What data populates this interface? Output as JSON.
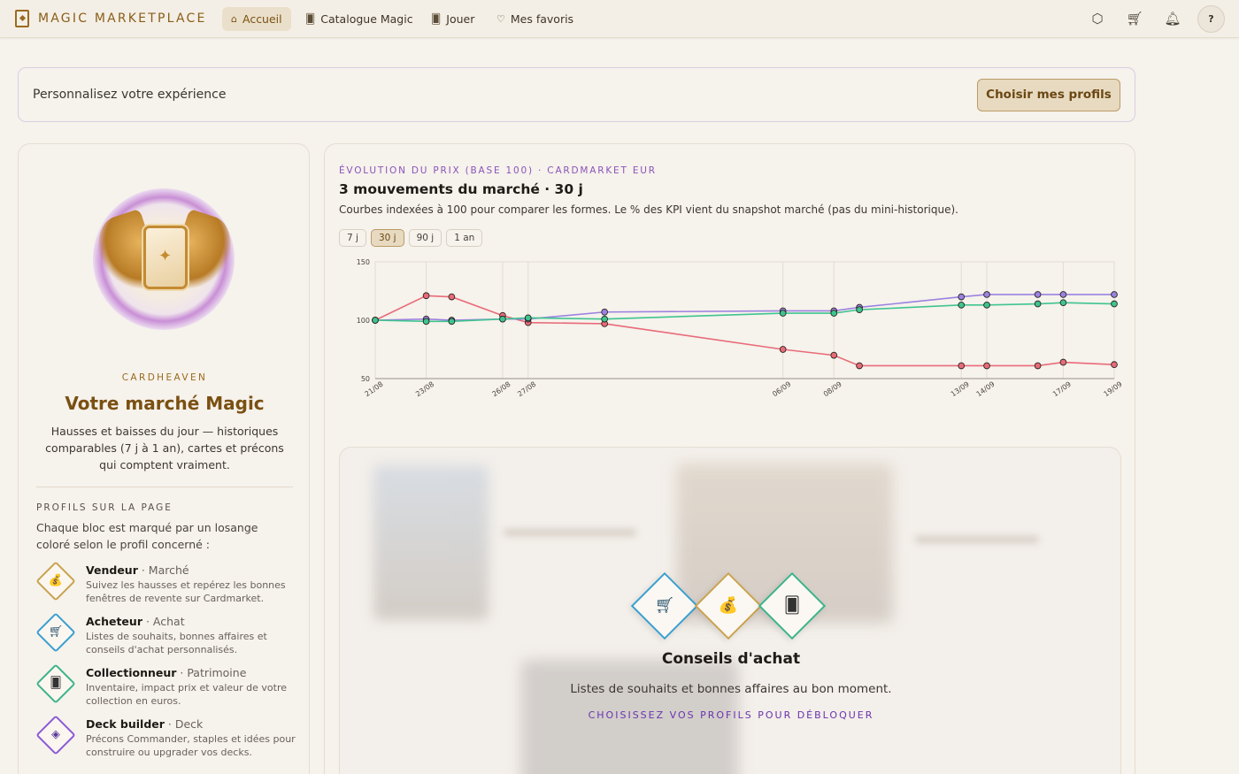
{
  "nav": {
    "brand": "MAGIC MARKETPLACE",
    "links": [
      {
        "label": "Accueil",
        "icon": "home-icon",
        "active": true
      },
      {
        "label": "Catalogue Magic",
        "icon": "cards-icon",
        "active": false
      },
      {
        "label": "Jouer",
        "icon": "cards-icon",
        "active": false
      },
      {
        "label": "Mes favoris",
        "icon": "heart-icon",
        "active": false
      }
    ],
    "right_icons": [
      "box-icon",
      "cart-icon",
      "bell-icon"
    ],
    "avatar_label": "?"
  },
  "banner": {
    "text": "Personnalisez votre expérience",
    "button": "Choisir mes profils"
  },
  "sidebar": {
    "kicker": "CARDHEAVEN",
    "title": "Votre marché Magic",
    "description": "Hausses et baisses du jour — historiques comparables (7 j à 1 an), cartes et précons qui comptent vraiment.",
    "profiles_heading": "PROFILS SUR LA PAGE",
    "profiles_intro": "Chaque bloc est marqué par un losange coloré selon le profil concerné :",
    "profiles": [
      {
        "name": "Vendeur",
        "tag": "Marché",
        "desc": "Suivez les hausses et repérez les bonnes fenêtres de revente sur Cardmarket.",
        "icon": "money-bag-icon",
        "color": "#c9a24f"
      },
      {
        "name": "Acheteur",
        "tag": "Achat",
        "desc": "Listes de souhaits, bonnes affaires et conseils d'achat personnalisés.",
        "icon": "cart-icon",
        "color": "#3a9fd0"
      },
      {
        "name": "Collectionneur",
        "tag": "Patrimoine",
        "desc": "Inventaire, impact prix et valeur de votre collection en euros.",
        "icon": "cards-icon",
        "color": "#3cb38a"
      },
      {
        "name": "Deck builder",
        "tag": "Deck",
        "desc": "Précons Commander, staples et idées pour construire ou upgrader vos decks.",
        "icon": "layers-icon",
        "color": "#8a5ad6"
      }
    ]
  },
  "chart_panel": {
    "kicker": "ÉVOLUTION DU PRIX (BASE 100) · CARDMARKET EUR",
    "title": "3 mouvements du marché · 30 j",
    "subtitle": "Courbes indexées à 100 pour comparer les formes. Le % des KPI vient du snapshot marché (pas du mini-historique).",
    "ranges": [
      {
        "label": "7 j",
        "active": false
      },
      {
        "label": "30 j",
        "active": true
      },
      {
        "label": "90 j",
        "active": false
      },
      {
        "label": "1 an",
        "active": false
      }
    ]
  },
  "chart_data": {
    "type": "line",
    "x": [
      "21/08",
      "23/08",
      "24/08",
      "26/08",
      "27/08",
      "30/08",
      "06/09",
      "08/09",
      "09/09",
      "13/09",
      "14/09",
      "16/09",
      "17/09",
      "19/09"
    ],
    "x_tick_labels": [
      "21/08",
      "23/08",
      "26/08",
      "27/08",
      "06/09",
      "08/09",
      "13/09",
      "14/09",
      "17/09",
      "19/09"
    ],
    "ylim": [
      50,
      150
    ],
    "y_ticks": [
      50,
      100,
      150
    ],
    "grid": true,
    "series": [
      {
        "color": "#e86b78",
        "values": [
          100,
          121,
          120,
          104,
          98,
          97,
          75,
          70,
          61,
          61,
          61,
          61,
          64,
          62
        ]
      },
      {
        "color": "#9b82e0",
        "values": [
          100,
          101,
          100,
          101,
          101,
          107,
          108,
          108,
          111,
          120,
          122,
          122,
          122,
          122
        ]
      },
      {
        "color": "#3fc48f",
        "values": [
          100,
          99,
          99,
          101,
          102,
          101,
          106,
          106,
          109,
          113,
          113,
          114,
          115,
          114
        ]
      }
    ]
  },
  "locked_panel": {
    "title": "Conseils d'achat",
    "description": "Listes de souhaits et bonnes affaires au bon moment.",
    "cta": "CHOISISSEZ VOS PROFILS POUR DÉBLOQUER",
    "badges": [
      {
        "icon": "cart-icon",
        "color": "#3a9fd0"
      },
      {
        "icon": "money-bag-icon",
        "color": "#c9a24f"
      },
      {
        "icon": "cards-icon",
        "color": "#3cb38a"
      }
    ]
  }
}
